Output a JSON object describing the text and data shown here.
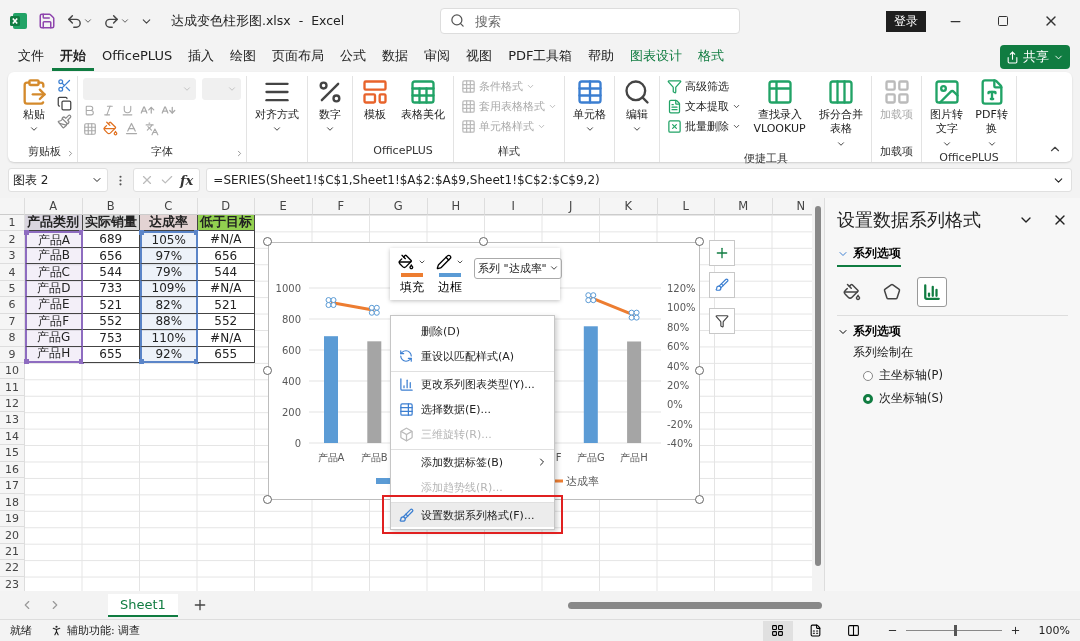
{
  "title_bar": {
    "file_title": "达成变色柱形图.xlsx  -  Excel",
    "search": {
      "placeholder": "搜索"
    },
    "sign_in": "登录"
  },
  "menu_tabs": [
    {
      "label": "文件",
      "selected": false,
      "kind": "normal"
    },
    {
      "label": "开始",
      "selected": true,
      "kind": "normal"
    },
    {
      "label": "OfficePLUS",
      "selected": false,
      "kind": "normal"
    },
    {
      "label": "插入",
      "selected": false,
      "kind": "normal"
    },
    {
      "label": "绘图",
      "selected": false,
      "kind": "normal"
    },
    {
      "label": "页面布局",
      "selected": false,
      "kind": "normal"
    },
    {
      "label": "公式",
      "selected": false,
      "kind": "normal"
    },
    {
      "label": "数据",
      "selected": false,
      "kind": "normal"
    },
    {
      "label": "审阅",
      "selected": false,
      "kind": "normal"
    },
    {
      "label": "视图",
      "selected": false,
      "kind": "normal"
    },
    {
      "label": "PDF工具箱",
      "selected": false,
      "kind": "normal"
    },
    {
      "label": "帮助",
      "selected": false,
      "kind": "normal"
    },
    {
      "label": "图表设计",
      "selected": false,
      "kind": "contextual"
    },
    {
      "label": "格式",
      "selected": false,
      "kind": "contextual"
    }
  ],
  "share_button": "共享",
  "ribbon": {
    "groups": [
      {
        "kind": "clipboard",
        "label": "剪贴板",
        "items": [
          {
            "kind": "large",
            "label": "粘贴",
            "dropdown": true,
            "disabled": false
          }
        ]
      },
      {
        "kind": "font",
        "label": "字体",
        "disabled": true
      },
      {
        "kind": "buttons",
        "items": [
          {
            "kind": "large",
            "label": "对齐方式",
            "dropdown": true,
            "disabled": false
          }
        ]
      },
      {
        "kind": "buttons",
        "items": [
          {
            "kind": "large",
            "label": "数字",
            "dropdown": true,
            "disabled": false
          }
        ]
      },
      {
        "kind": "buttons",
        "label": "OfficePLUS",
        "items": [
          {
            "kind": "large",
            "label": "模板",
            "dropdown": false,
            "disabled": false
          },
          {
            "kind": "large",
            "label": "表格美化",
            "dropdown": false,
            "disabled": false
          }
        ]
      },
      {
        "kind": "buttons",
        "label": "样式",
        "items": [
          {
            "kind": "stack",
            "items": [
              {
                "label": "条件格式",
                "dropdown": true,
                "disabled": true
              },
              {
                "label": "套用表格格式",
                "dropdown": true,
                "disabled": true
              },
              {
                "label": "单元格样式",
                "dropdown": true,
                "disabled": true
              }
            ]
          }
        ]
      },
      {
        "kind": "buttons",
        "items": [
          {
            "kind": "large",
            "label": "单元格",
            "dropdown": true,
            "disabled": false
          }
        ]
      },
      {
        "kind": "buttons",
        "items": [
          {
            "kind": "large",
            "label": "编辑",
            "dropdown": true,
            "disabled": false
          }
        ]
      },
      {
        "kind": "buttons",
        "label": "便捷工具",
        "items": [
          {
            "kind": "stack",
            "items": [
              {
                "label": "高级筛选",
                "dropdown": false,
                "disabled": false
              },
              {
                "label": "文本提取",
                "dropdown": true,
                "disabled": false
              },
              {
                "label": "批量删除",
                "dropdown": true,
                "disabled": false
              }
            ]
          },
          {
            "kind": "large",
            "label": "查找录入 VLOOKUP",
            "dropdown": false,
            "disabled": false
          },
          {
            "kind": "large",
            "label": "拆分合并表格",
            "dropdown": true,
            "disabled": false
          }
        ]
      },
      {
        "kind": "buttons",
        "label": "加载项",
        "items": [
          {
            "kind": "large",
            "label": "加载项",
            "dropdown": false,
            "disabled": true
          }
        ]
      },
      {
        "kind": "buttons",
        "label": "OfficePLUS",
        "items": [
          {
            "kind": "large",
            "label": "图片转文字",
            "dropdown": true,
            "disabled": false
          },
          {
            "kind": "large",
            "label": "PDF转换",
            "dropdown": true,
            "disabled": false
          }
        ]
      }
    ]
  },
  "formula_bar": {
    "name_box": "图表 2",
    "function_label": "fx",
    "formula": "=SERIES(Sheet1!$C$1,Sheet1!$A$2:$A$9,Sheet1!$C$2:$C$9,2)"
  },
  "sheet": {
    "columns": [
      {
        "label": "A",
        "color": "#8e6cc0"
      },
      {
        "label": "B"
      },
      {
        "label": "C",
        "color": "#5b85c8"
      },
      {
        "label": "D"
      },
      {
        "label": "E"
      },
      {
        "label": "F"
      },
      {
        "label": "G"
      },
      {
        "label": "H"
      },
      {
        "label": "I"
      },
      {
        "label": "J"
      },
      {
        "label": "K"
      },
      {
        "label": "L"
      },
      {
        "label": "M"
      },
      {
        "label": "N"
      }
    ],
    "rows": [
      {
        "number": "1",
        "cells": [
          {
            "text": "产品类别",
            "color": "#d9d5df"
          },
          {
            "text": "实际销量",
            "color": "#d9d9d9"
          },
          {
            "text": "达成率",
            "color": "#e3d3d3"
          },
          {
            "text": "低于目标",
            "color": "#92d050"
          }
        ]
      },
      {
        "number": "2",
        "cells": [
          {
            "text": "产品A"
          },
          {
            "text": "689"
          },
          {
            "text": "105%"
          },
          {
            "text": "#N/A"
          }
        ]
      },
      {
        "number": "3",
        "cells": [
          {
            "text": "产品B"
          },
          {
            "text": "656"
          },
          {
            "text": "97%"
          },
          {
            "text": "656"
          }
        ]
      },
      {
        "number": "4",
        "cells": [
          {
            "text": "产品C"
          },
          {
            "text": "544"
          },
          {
            "text": "79%"
          },
          {
            "text": "544"
          }
        ]
      },
      {
        "number": "5",
        "cells": [
          {
            "text": "产品D"
          },
          {
            "text": "733"
          },
          {
            "text": "109%"
          },
          {
            "text": "#N/A"
          }
        ]
      },
      {
        "number": "6",
        "cells": [
          {
            "text": "产品E"
          },
          {
            "text": "521"
          },
          {
            "text": "82%"
          },
          {
            "text": "521"
          }
        ]
      },
      {
        "number": "7",
        "cells": [
          {
            "text": "产品F"
          },
          {
            "text": "552"
          },
          {
            "text": "88%"
          },
          {
            "text": "552"
          }
        ]
      },
      {
        "number": "8",
        "cells": [
          {
            "text": "产品G"
          },
          {
            "text": "753"
          },
          {
            "text": "110%"
          },
          {
            "text": "#N/A"
          }
        ]
      },
      {
        "number": "9",
        "cells": [
          {
            "text": "产品H"
          },
          {
            "text": "655"
          },
          {
            "text": "92%"
          },
          {
            "text": "655"
          }
        ]
      },
      {
        "number": "10"
      },
      {
        "number": "11"
      },
      {
        "number": "12"
      },
      {
        "number": "13"
      },
      {
        "number": "14"
      },
      {
        "number": "15"
      },
      {
        "number": "16"
      },
      {
        "number": "17"
      },
      {
        "number": "18"
      },
      {
        "number": "19"
      },
      {
        "number": "20"
      },
      {
        "number": "21"
      },
      {
        "number": "22"
      },
      {
        "number": "23"
      }
    ]
  },
  "chart": {
    "format_toolbar": {
      "fill": {
        "label": "填充",
        "color": "#ed7d31"
      },
      "border": {
        "label": "边框",
        "color": "#5b9bd5"
      },
      "series_select": "系列 \"达成率\""
    },
    "chart_data": {
      "type": "bar",
      "grid": true,
      "categories": [
        "产品A",
        "产品B",
        null,
        null,
        null,
        "F",
        "产品G",
        "产品H"
      ],
      "series": [
        {
          "color": "#5b9bd5",
          "values": [
            689,
            null,
            null,
            null,
            null,
            null,
            753,
            null
          ]
        },
        {
          "color": "#a5a5a5",
          "values": [
            null,
            656,
            null,
            null,
            null,
            null,
            null,
            655
          ]
        },
        {
          "name": "达成率",
          "type": "line",
          "axis": "y2",
          "color": "#ed7d31",
          "values": [
            1.05,
            0.97,
            null,
            null,
            null,
            null,
            1.1,
            0.92
          ]
        }
      ],
      "ylim": [
        0,
        1000
      ],
      "yticks": [
        0,
        200,
        400,
        600,
        800,
        1000
      ],
      "y2lim": [
        -0.4,
        1.2
      ],
      "y2ticks": [
        {
          "value": -0.4,
          "label": "-40%"
        },
        {
          "value": -0.2,
          "label": "-20%"
        },
        {
          "value": 0,
          "label": "0%"
        },
        {
          "value": 0.2,
          "label": "20%"
        },
        {
          "value": 0.4,
          "label": "40%"
        },
        {
          "value": 0.6,
          "label": "60%"
        },
        {
          "value": 0.8,
          "label": "80%"
        },
        {
          "value": 1,
          "label": "100%"
        },
        {
          "value": 1.2,
          "label": "120%"
        }
      ]
    }
  },
  "context_menu": {
    "items": [
      {
        "label": "删除(D)",
        "disabled": false,
        "submenu": false,
        "separator_before": false,
        "highlighted": false
      },
      {
        "label": "重设以匹配样式(A)",
        "disabled": false,
        "submenu": false,
        "separator_before": false,
        "highlighted": false
      },
      {
        "label": "更改系列图表类型(Y)...",
        "disabled": false,
        "submenu": false,
        "separator_before": true,
        "highlighted": false
      },
      {
        "label": "选择数据(E)...",
        "disabled": false,
        "submenu": false,
        "separator_before": false,
        "highlighted": false
      },
      {
        "label": "三维旋转(R)...",
        "disabled": true,
        "submenu": false,
        "separator_before": false,
        "highlighted": false
      },
      {
        "label": "添加数据标签(B)",
        "disabled": false,
        "submenu": true,
        "separator_before": true,
        "highlighted": false
      },
      {
        "label": "添加趋势线(R)...",
        "disabled": true,
        "submenu": false,
        "separator_before": false,
        "highlighted": false
      },
      {
        "label": "设置数据系列格式(F)...",
        "disabled": false,
        "submenu": false,
        "separator_before": true,
        "highlighted": true
      }
    ]
  },
  "format_pane": {
    "title": "设置数据系列格式",
    "tab": {
      "label": "系列选项",
      "selected": true
    },
    "icon_tabs": [
      {
        "selected": false
      },
      {
        "selected": false
      },
      {
        "selected": true
      }
    ],
    "section": {
      "title": "系列选项",
      "expanded": true,
      "caption": "系列绘制在",
      "options": [
        {
          "label": "主坐标轴(P)",
          "selected": false
        },
        {
          "label": "次坐标轴(S)",
          "selected": true
        }
      ]
    }
  },
  "sheet_tabs": [
    {
      "label": "Sheet1",
      "selected": true
    }
  ],
  "status_bar": {
    "mode": "就绪",
    "accessibility": "辅助功能: 调查",
    "views": [
      {
        "selected": true
      },
      {
        "selected": false
      },
      {
        "selected": false
      }
    ],
    "zoom_slider": {
      "level": 0.5
    },
    "zoom": "100%"
  }
}
